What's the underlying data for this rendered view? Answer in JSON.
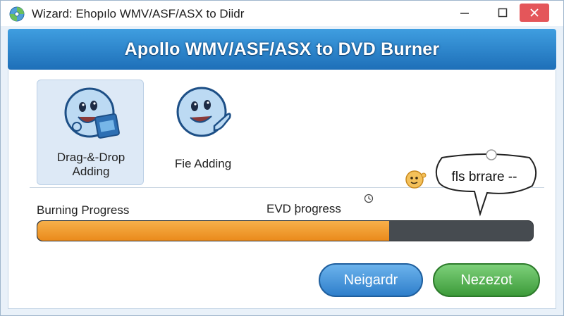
{
  "window": {
    "title": "Wizard: Ehopılo WMV/ASF/ASX to Diidr",
    "controls": [
      "minimize-icon",
      "maximize-icon",
      "close-icon"
    ]
  },
  "banner": {
    "title": "Apollo WMV/ASF/ASX to DVD Burner"
  },
  "modes": [
    {
      "label": "Drag-&-Drop\nAdding",
      "selected": true,
      "icon": "smiley-mascot-icon"
    },
    {
      "label": "Fie Adding",
      "selected": false,
      "icon": "smiley-pointing-icon"
    }
  ],
  "bubble": {
    "text": "fls brrare --"
  },
  "progress": {
    "label": "Burning Progress",
    "secondary_label": "EVD þrogress",
    "value": 0.71
  },
  "buttons": {
    "back": "Neigardr",
    "next": "Nezezot"
  },
  "colors": {
    "banner": "#2b84cf",
    "progress_fill": "#f09a2a",
    "progress_track": "#464b50",
    "back_button": "#3f8fd6",
    "next_button": "#4caf48",
    "close_button": "#e4565a"
  }
}
